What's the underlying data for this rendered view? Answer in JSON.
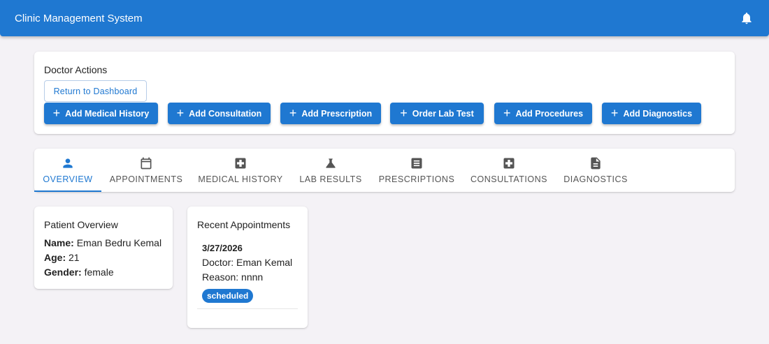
{
  "app": {
    "title": "Clinic Management System",
    "accent": "#1f78d1"
  },
  "header": {
    "notification_icon": "bell-icon"
  },
  "doctor_actions": {
    "title": "Doctor Actions",
    "return_label": "Return to Dashboard",
    "buttons": [
      {
        "label": "Add Medical History",
        "icon": "plus-icon"
      },
      {
        "label": "Add Consultation",
        "icon": "plus-icon"
      },
      {
        "label": "Add Prescription",
        "icon": "plus-icon"
      },
      {
        "label": "Order Lab Test",
        "icon": "plus-icon"
      },
      {
        "label": "Add Procedures",
        "icon": "plus-icon"
      },
      {
        "label": "Add Diagnostics",
        "icon": "plus-icon"
      }
    ]
  },
  "tabs": {
    "selected": "OVERVIEW",
    "items": [
      {
        "label": "OVERVIEW",
        "icon": "person-icon"
      },
      {
        "label": "APPOINTMENTS",
        "icon": "calendar-icon"
      },
      {
        "label": "MEDICAL HISTORY",
        "icon": "medical-cross-icon"
      },
      {
        "label": "LAB RESULTS",
        "icon": "flask-icon"
      },
      {
        "label": "PRESCRIPTIONS",
        "icon": "list-icon"
      },
      {
        "label": "CONSULTATIONS",
        "icon": "medical-cross-icon"
      },
      {
        "label": "DIAGNOSTICS",
        "icon": "document-icon"
      }
    ]
  },
  "patient_overview": {
    "title": "Patient Overview",
    "name_label": "Name:",
    "name": "Eman Bedru Kemal",
    "age_label": "Age:",
    "age": "21",
    "gender_label": "Gender:",
    "gender": "female"
  },
  "recent_appointments": {
    "title": "Recent Appointments",
    "items": [
      {
        "date": "3/27/2026",
        "doctor": "Doctor: Eman Kemal",
        "reason": "Reason: nnnn",
        "status": "scheduled"
      }
    ]
  }
}
